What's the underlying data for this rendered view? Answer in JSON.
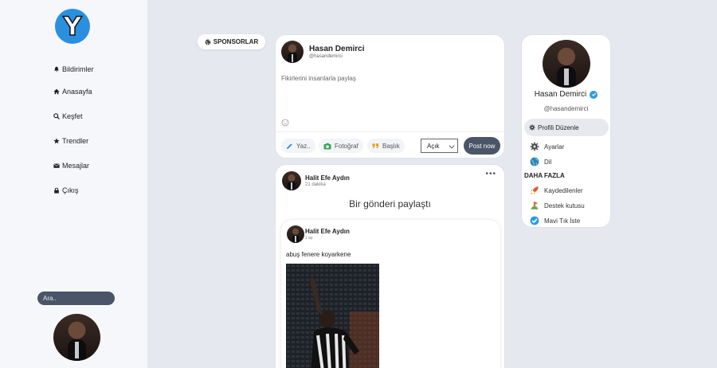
{
  "app": {
    "logo_letter": "Y"
  },
  "sidebar": {
    "items": [
      {
        "label": "Bildirimler",
        "icon": "bell-icon"
      },
      {
        "label": "Anasayfa",
        "icon": "home-icon"
      },
      {
        "label": "Keşfet",
        "icon": "search-icon"
      },
      {
        "label": "Trendler",
        "icon": "star-icon"
      },
      {
        "label": "Mesajlar",
        "icon": "envelope-icon"
      },
      {
        "label": "Çıkış",
        "icon": "lock-icon"
      }
    ],
    "search_placeholder": "Ara.."
  },
  "sponsor": {
    "label": "SPONSORLAR",
    "icon": "globe-icon"
  },
  "composer": {
    "name": "Hasan Demirci",
    "handle": "@hasandemirci",
    "placeholder": "Fikirlerini insanlarla paylaş",
    "tools": [
      {
        "label": "Yaz..",
        "icon": "pencil-icon"
      },
      {
        "label": "Fotoğraf",
        "icon": "camera-icon"
      },
      {
        "label": "Başlık",
        "icon": "quote-icon"
      }
    ],
    "visibility": "Açık",
    "post_label": "Post now"
  },
  "post": {
    "author": "Halit Efe Aydın",
    "time": "21 dakika",
    "shared_text": "Bir gönderi paylaştı",
    "inner": {
      "author": "Halit Efe Aydın",
      "time": "1 ay",
      "text": "abuş fenere koyarkene"
    }
  },
  "profile": {
    "name": "Hasan Demirci",
    "handle": "@hasandemirci",
    "edit_label": "Profili Düzenle",
    "items": [
      {
        "label": "Ayarlar",
        "icon": "gear-icon",
        "color": "#444"
      },
      {
        "label": "Dil",
        "icon": "globe-icon",
        "color": "#2a7ed0"
      }
    ],
    "more_heading": "DAHA FAZLA",
    "more_items": [
      {
        "label": "Kaydedilenler",
        "icon": "rocket-icon",
        "color": "#e05a3a"
      },
      {
        "label": "Destek kutusu",
        "icon": "support-icon",
        "color": "#6aa04a"
      },
      {
        "label": "Mavi Tık İste",
        "icon": "check-badge-icon",
        "color": "#2a9be0"
      }
    ]
  }
}
